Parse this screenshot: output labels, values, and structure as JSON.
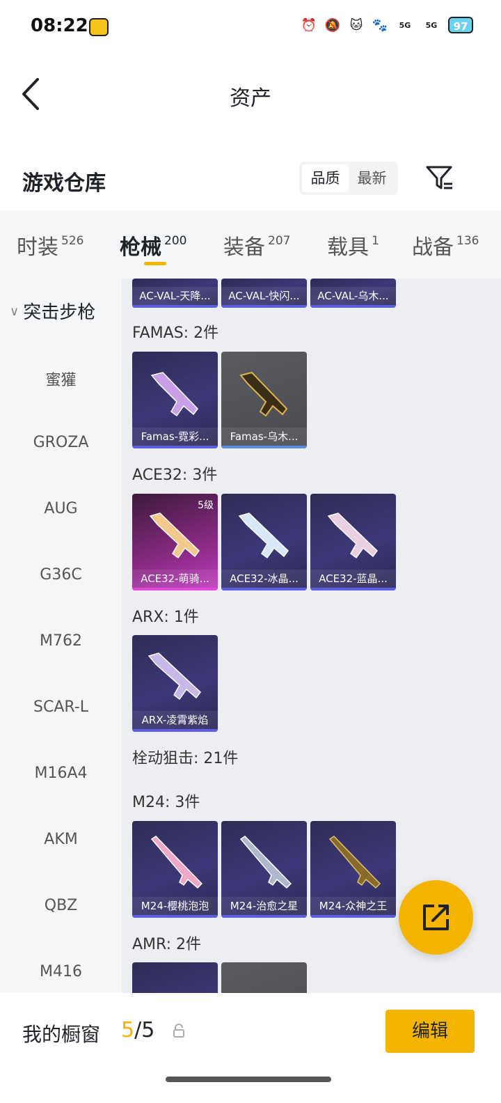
{
  "status_bar": {
    "time": "08:22",
    "signal_1": "5G",
    "signal_2": "5G",
    "battery": "97"
  },
  "header": {
    "title": "资产"
  },
  "warehouse": {
    "title": "游戏仓库",
    "sort_options": [
      "品质",
      "最新"
    ],
    "active_sort": "品质"
  },
  "tabs": [
    {
      "label": "时装",
      "count": "526"
    },
    {
      "label": "枪械",
      "count": "200"
    },
    {
      "label": "装备",
      "count": "207"
    },
    {
      "label": "载具",
      "count": "1"
    },
    {
      "label": "战备",
      "count": "136"
    }
  ],
  "active_tab": "枪械",
  "sidebar": {
    "category": "突击步枪",
    "items": [
      "蜜獾",
      "GROZA",
      "AUG",
      "G36C",
      "M762",
      "SCAR-L",
      "M16A4",
      "AKM",
      "QBZ",
      "M416"
    ]
  },
  "content": {
    "top_partial": [
      "AC-VAL-天降...",
      "AC-VAL-快闪...",
      "AC-VAL-乌木..."
    ],
    "groups": [
      {
        "title": "FAMAS: 2件",
        "cards": [
          {
            "label": "Famas-霓彩...",
            "style": "purple"
          },
          {
            "label": "Famas-乌木...",
            "style": "gray"
          }
        ]
      },
      {
        "title": "ACE32: 3件",
        "cards": [
          {
            "label": "ACE32-萌骑...",
            "style": "pink",
            "level": "5级"
          },
          {
            "label": "ACE32-冰晶...",
            "style": "purple"
          },
          {
            "label": "ACE32-蓝晶...",
            "style": "purple"
          }
        ]
      },
      {
        "title": "ARX: 1件",
        "cards": [
          {
            "label": "ARX-凌霄紫焰",
            "style": "purple"
          }
        ]
      },
      {
        "title": "栓动狙击: 21件",
        "cards": []
      },
      {
        "title": "M24: 3件",
        "cards": [
          {
            "label": "M24-樱桃泡泡",
            "style": "purple"
          },
          {
            "label": "M24-治愈之星",
            "style": "purple"
          },
          {
            "label": "M24-众神之王",
            "style": "purple"
          }
        ]
      },
      {
        "title": "AMR: 2件",
        "cards": []
      }
    ]
  },
  "bottom": {
    "showcase_label": "我的橱窗",
    "showcase_current": "5",
    "showcase_total": "/5",
    "edit_label": "编辑"
  },
  "colors": {
    "accent": "#f5b400",
    "purple_card": "#3d3878",
    "gray_card": "#4a4b50",
    "pink_card": "#8a2a84"
  }
}
